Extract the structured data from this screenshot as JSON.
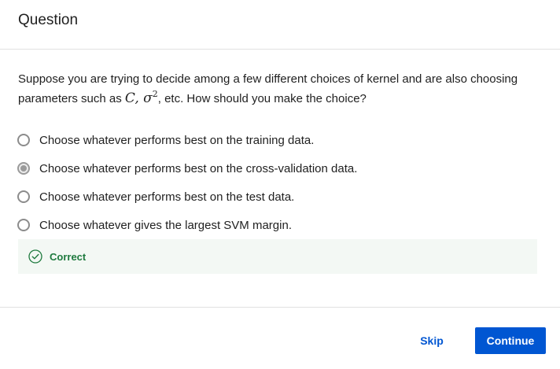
{
  "header": {
    "title": "Question"
  },
  "question": {
    "text_before": "Suppose you are trying to decide among a few different choices of kernel and are also choosing parameters such as ",
    "math_c": "C",
    "math_sep": ", ",
    "math_sigma": "σ",
    "math_exp": "2",
    "text_after": ", etc. How should you make the choice?"
  },
  "options": [
    {
      "label": "Choose whatever performs best on the training data.",
      "selected": false
    },
    {
      "label": "Choose whatever performs best on the cross-validation data.",
      "selected": true
    },
    {
      "label": "Choose whatever performs best on the test data.",
      "selected": false
    },
    {
      "label": "Choose whatever gives the largest SVM margin.",
      "selected": false
    }
  ],
  "feedback": {
    "status": "Correct",
    "icon": "check-circle-icon",
    "color": "#1e7a3e"
  },
  "footer": {
    "skip_label": "Skip",
    "continue_label": "Continue"
  },
  "colors": {
    "accent": "#0056d2",
    "success": "#1e7a3e",
    "success_bg": "#f3f8f4"
  }
}
